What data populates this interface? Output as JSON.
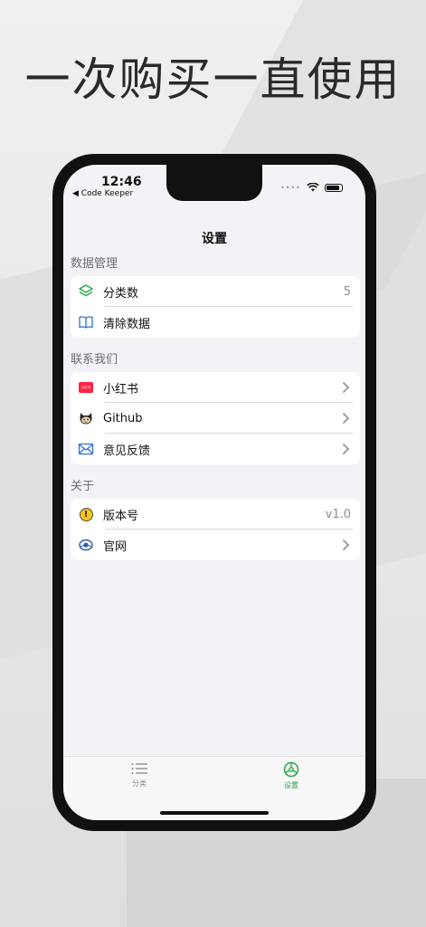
{
  "promo": {
    "headline": "一次购买一直使用"
  },
  "status_bar": {
    "time": "12:46",
    "back_label": "◀ Code Keeper",
    "signal": "••••"
  },
  "nav": {
    "title": "设置"
  },
  "sections": {
    "data_management": {
      "header": "数据管理",
      "rows": [
        {
          "label": "分类数",
          "value": "5",
          "icon": "layers-icon"
        },
        {
          "label": "清除数据",
          "icon": "book-icon"
        }
      ]
    },
    "contact_us": {
      "header": "联系我们",
      "rows": [
        {
          "label": "小红书",
          "icon": "xiaohongshu-icon",
          "icon_text": "小红书"
        },
        {
          "label": "Github",
          "icon": "github-icon"
        },
        {
          "label": "意见反馈",
          "icon": "mail-icon"
        }
      ]
    },
    "about": {
      "header": "关于",
      "rows": [
        {
          "label": "版本号",
          "value": "v1.0",
          "icon": "info-icon",
          "icon_text": "!"
        },
        {
          "label": "官网",
          "icon": "globe-icon"
        }
      ]
    }
  },
  "tabbar": {
    "tabs": [
      {
        "label": "分类",
        "icon": "list-icon",
        "active": false
      },
      {
        "label": "设置",
        "icon": "settings-icon",
        "active": true
      }
    ]
  },
  "colors": {
    "accent": "#27a845",
    "inactive": "#8e8e93",
    "xiaohongshu": "#ff2442",
    "info_badge": "#f5c518"
  }
}
